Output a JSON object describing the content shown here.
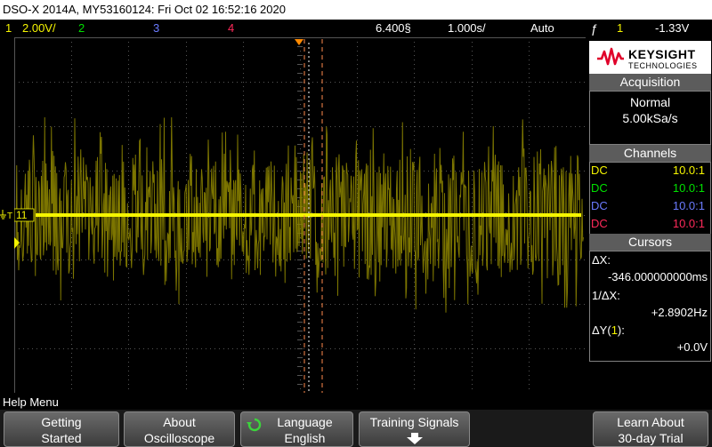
{
  "titlebar": {
    "text": "DSO-X 2014A, MY53160124: Fri Oct 02 16:52:16 2020"
  },
  "status": {
    "ch1_num": "1",
    "ch1_scale": "2.00V/",
    "ch2_num": "2",
    "ch3_num": "3",
    "ch4_num": "4",
    "time_delay": "6.400§",
    "time_scale": "1.000s/",
    "trigger_mode": "Auto",
    "trigger_channel": "1",
    "trigger_level": "-1.33V"
  },
  "colors": {
    "ch1": "#f5f500",
    "ch2": "#00e000",
    "ch3": "#6b7bff",
    "ch4": "#ff2a5a",
    "cursor": "#ff8a4c",
    "grid": "#555555",
    "brand_red": "#e0002a"
  },
  "waveform": {
    "marker_label": "11"
  },
  "brand": {
    "name": "KEYSIGHT",
    "sub": "TECHNOLOGIES"
  },
  "acquisition": {
    "title": "Acquisition",
    "mode": "Normal",
    "rate": "5.00kSa/s"
  },
  "channels": {
    "title": "Channels",
    "rows": [
      {
        "coupling": "DC",
        "ratio": "10.0:1"
      },
      {
        "coupling": "DC",
        "ratio": "10.0:1"
      },
      {
        "coupling": "DC",
        "ratio": "10.0:1"
      },
      {
        "coupling": "DC",
        "ratio": "10.0:1"
      }
    ]
  },
  "cursors": {
    "title": "Cursors",
    "dx_label": "ΔX:",
    "dx_value": "-346.000000000ms",
    "inv_dx_label": "1/ΔX:",
    "inv_dx_value": "+2.8902Hz",
    "dy_label": "ΔY(",
    "dy_channel": "1",
    "dy_label_end": "):",
    "dy_value": "+0.0V"
  },
  "help": {
    "text": "Help Menu"
  },
  "softkeys": [
    {
      "line1": "Getting",
      "line2": "Started"
    },
    {
      "line1": "About",
      "line2": "Oscilloscope"
    },
    {
      "line1": "Language",
      "line2": "English"
    },
    {
      "line1": "Training Signals",
      "line2": ""
    },
    {
      "line1": "Learn About",
      "line2": "30-day Trial"
    }
  ]
}
